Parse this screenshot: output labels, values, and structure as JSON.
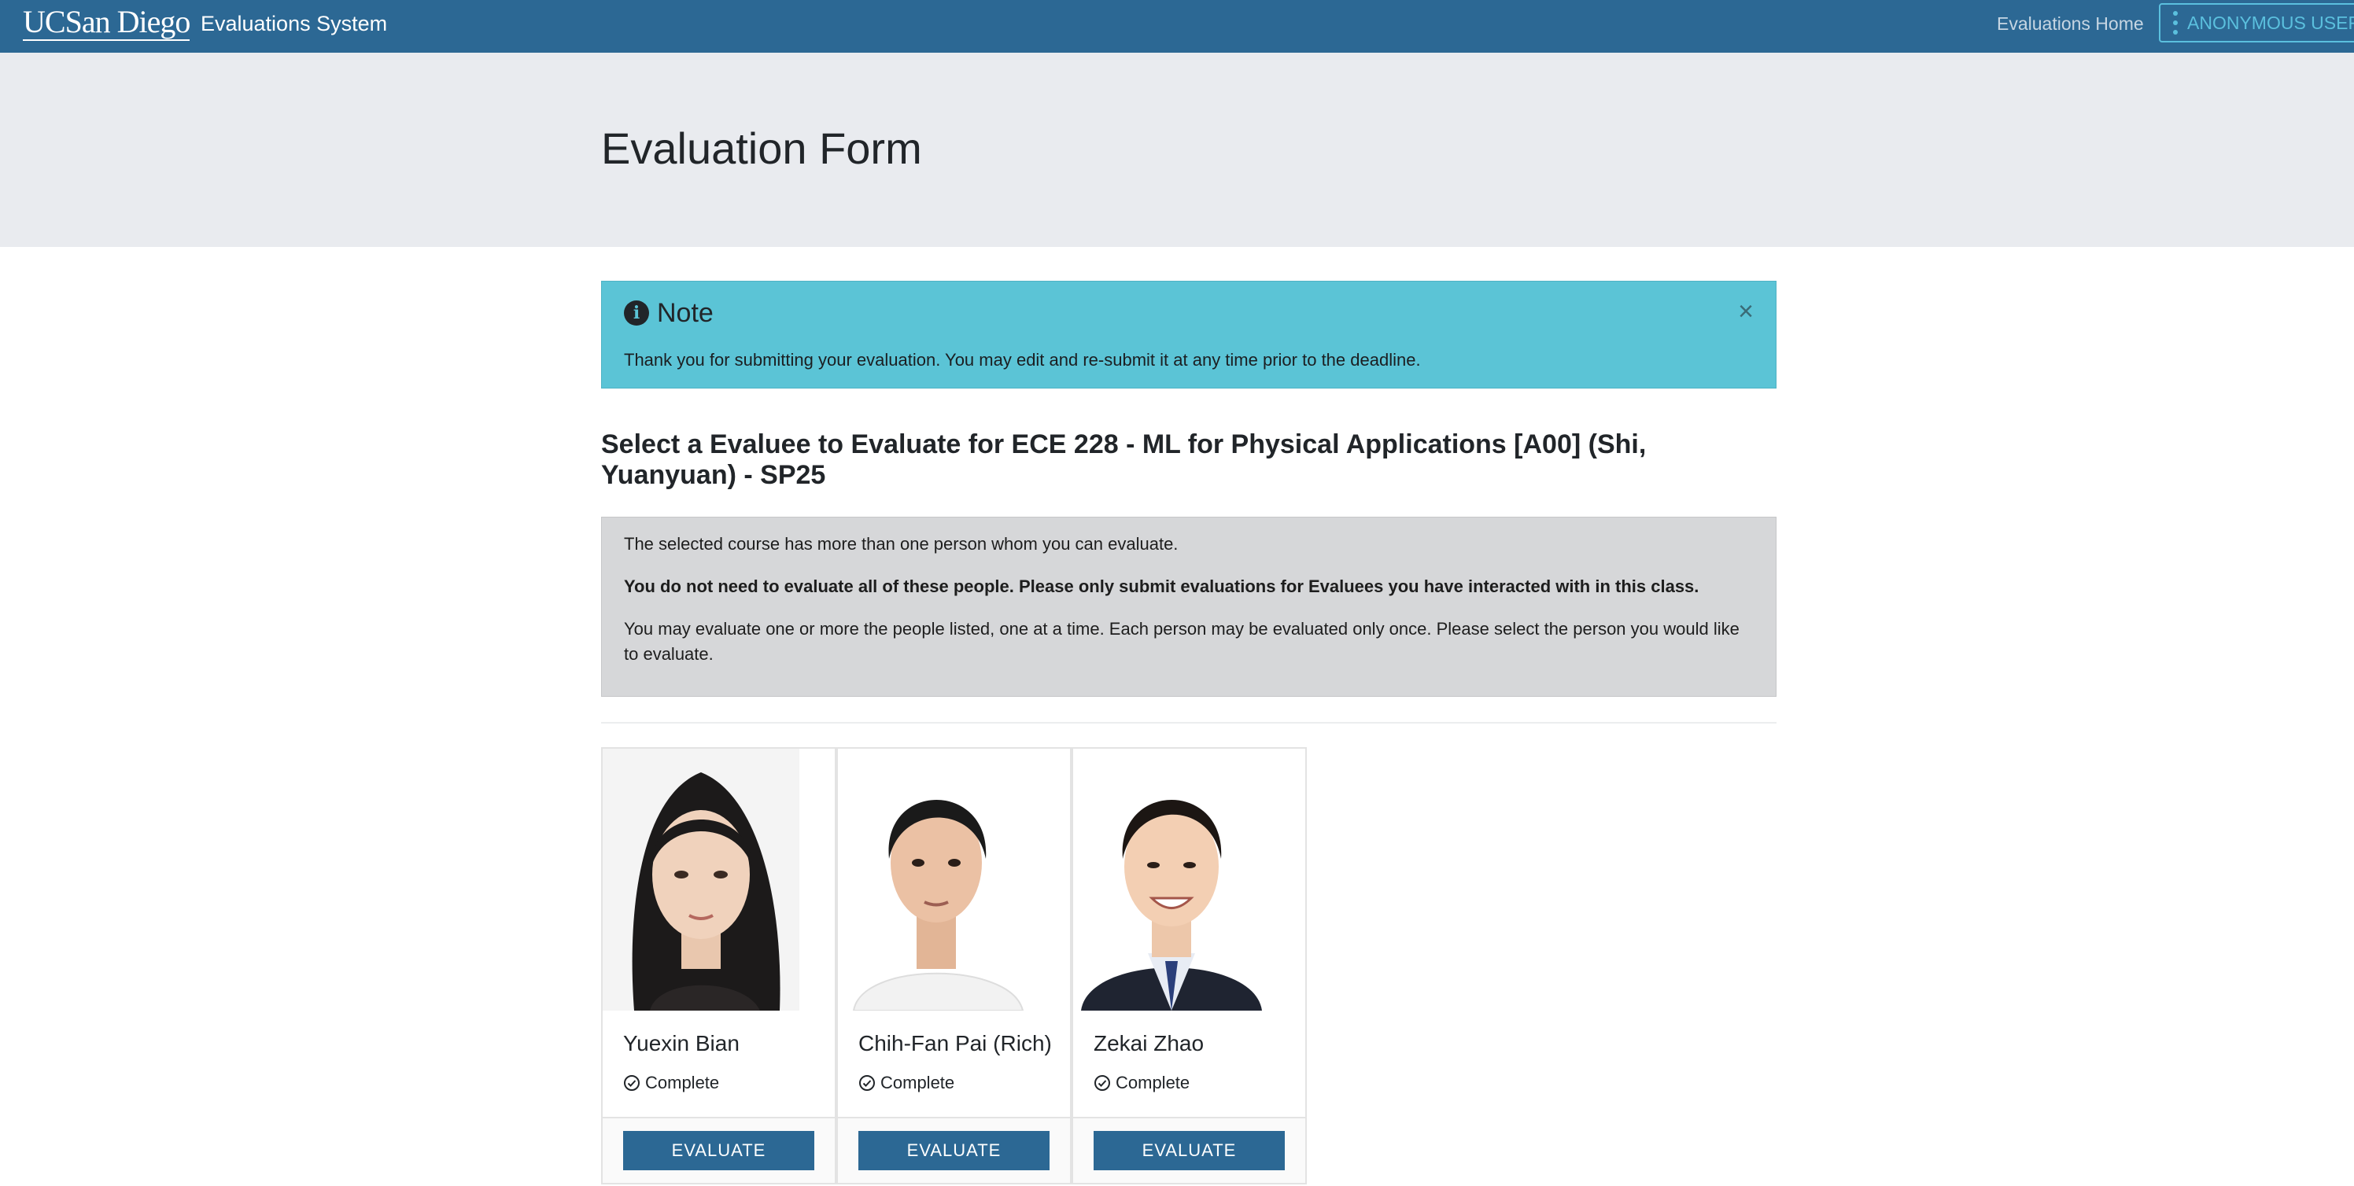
{
  "navbar": {
    "logo": "UCSan Diego",
    "title": "Evaluations System",
    "home_link": "Evaluations Home",
    "user_button": "ANONYMOUS USER"
  },
  "page": {
    "title": "Evaluation Form"
  },
  "alert": {
    "icon": "info-circle-icon",
    "heading": "Note",
    "message": "Thank you for submitting your evaluation. You may edit and re-submit it at any time prior to the deadline.",
    "close": "×"
  },
  "section": {
    "heading": "Select a Evaluee to Evaluate for ECE 228 - ML for Physical Applications [A00] (Shi, Yuanyuan) - SP25"
  },
  "info": {
    "line1": "The selected course has more than one person whom you can evaluate.",
    "line2": "You do not need to evaluate all of these people. Please only submit evaluations for Evaluees you have interacted with in this class.",
    "line3": "You may evaluate one or more the people listed, one at a time. Each person may be evaluated only once. Please select the person you would like to evaluate."
  },
  "evaluees": [
    {
      "name": "Yuexin Bian",
      "status": "Complete",
      "button": "EVALUATE"
    },
    {
      "name": "Chih-Fan Pai (Rich)",
      "status": "Complete",
      "button": "EVALUATE"
    },
    {
      "name": "Zekai Zhao",
      "status": "Complete",
      "button": "EVALUATE"
    }
  ],
  "colors": {
    "navbar": "#2c6894",
    "hero": "#e9ebef",
    "alert": "#5bc4d6",
    "info_box": "#d6d7d9",
    "button": "#2c6894"
  }
}
